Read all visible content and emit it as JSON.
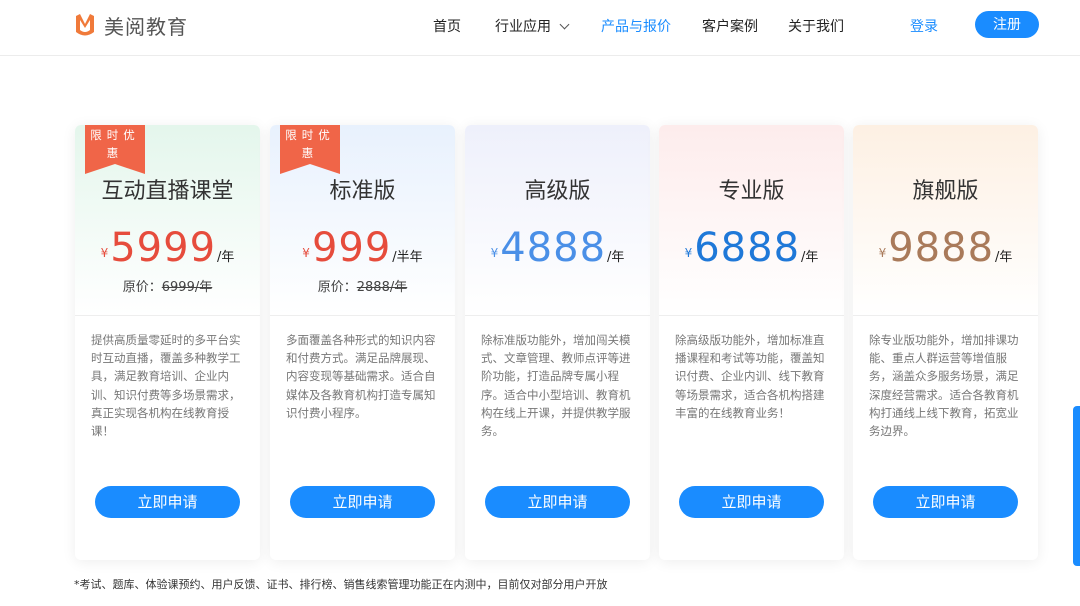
{
  "header": {
    "brand": "美阅教育",
    "nav": [
      {
        "label": "首页",
        "active": false
      },
      {
        "label": "行业应用",
        "active": false,
        "dropdown": true
      },
      {
        "label": "产品与报价",
        "active": true
      },
      {
        "label": "客户案例",
        "active": false
      },
      {
        "label": "关于我们",
        "active": false
      }
    ],
    "login": "登录",
    "register": "注册"
  },
  "plans": [
    {
      "name": "互动直播课堂",
      "badge": "限时优惠",
      "currency": "¥",
      "price": "5999",
      "unit": "/年",
      "original_label": "原价：",
      "original_price": "6999/年",
      "price_color": "#e64c3c",
      "description": "提供高质量零延时的多平台实时互动直播，覆盖多种教学工具，满足教育培训、企业内训、知识付费等多场景需求，真正实现各机构在线教育授课！",
      "button": "立即申请",
      "gradient": [
        "#e4f6ec",
        "#ffffff"
      ]
    },
    {
      "name": "标准版",
      "badge": "限时优惠",
      "currency": "¥",
      "price": "999",
      "unit": "/半年",
      "original_label": "原价：",
      "original_price": "2888/年",
      "price_color": "#e64c3c",
      "description": "多面覆盖各种形式的知识内容和付费方式。满足品牌展现、内容变现等基础需求。适合自媒体及各教育机构打造专属知识付费小程序。",
      "button": "立即申请",
      "gradient": [
        "#e8f1fd",
        "#ffffff"
      ]
    },
    {
      "name": "高级版",
      "currency": "¥",
      "price": "4888",
      "unit": "/年",
      "price_color": "#4a8fe7",
      "description": "除标准版功能外，增加闯关模式、文章管理、教师点评等进阶功能，打造品牌专属小程序。适合中小型培训、教育机构在线上开课，并提供教学服务。",
      "button": "立即申请",
      "gradient": [
        "#eef0fb",
        "#ffffff"
      ]
    },
    {
      "name": "专业版",
      "currency": "¥",
      "price": "6888",
      "unit": "/年",
      "price_color": "#1f78d8",
      "description": "除高级版功能外，增加标准直播课程和考试等功能，覆盖知识付费、企业内训、线下教育等场景需求，适合各机构搭建丰富的在线教育业务！",
      "button": "立即申请",
      "gradient": [
        "#fdecec",
        "#ffffff"
      ]
    },
    {
      "name": "旗舰版",
      "currency": "¥",
      "price": "9888",
      "unit": "/年",
      "price_color": "#a97a5a",
      "description": "除专业版功能外，增加排课功能、重点人群运营等增值服务，涵盖众多服务场景，满足深度经营需求。适合各教育机构打通线上线下教育，拓宽业务边界。",
      "button": "立即申请",
      "gradient": [
        "#fdf0e3",
        "#ffffff"
      ]
    }
  ],
  "footnote": "*考试、题库、体验课预约、用户反馈、证书、排行榜、销售线索管理功能正在内测中，目前仅对部分用户开放",
  "colors": {
    "accent": "#1a8cff",
    "badge": "#f06548"
  }
}
